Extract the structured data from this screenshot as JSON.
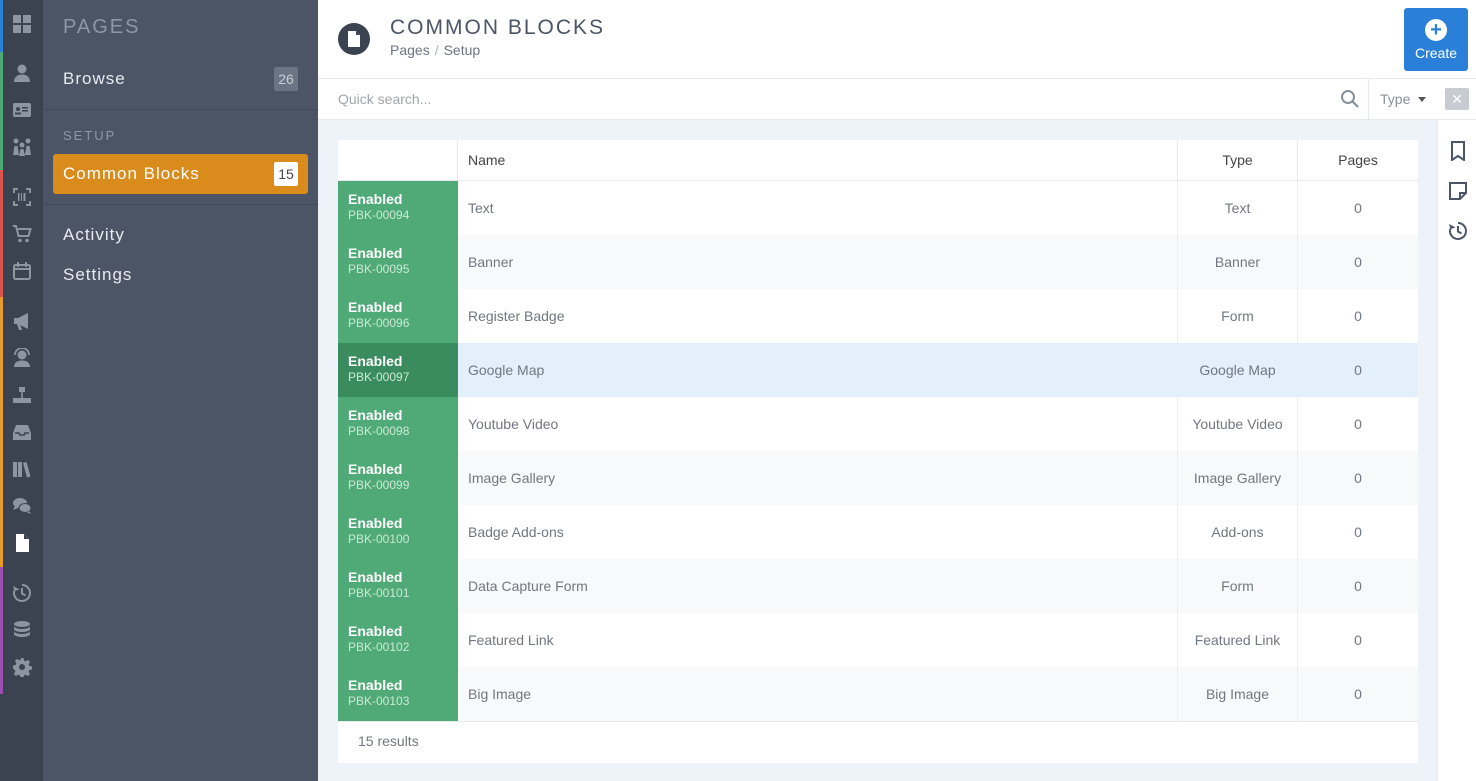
{
  "sidebar": {
    "title": "PAGES",
    "browse": {
      "label": "Browse",
      "count": "26"
    },
    "section_label": "SETUP",
    "common_blocks": {
      "label": "Common Blocks",
      "count": "15"
    },
    "activity_label": "Activity",
    "settings_label": "Settings"
  },
  "header": {
    "title": "COMMON BLOCKS",
    "breadcrumb": [
      "Pages",
      "Setup"
    ],
    "create_label": "Create"
  },
  "search": {
    "placeholder": "Quick search...",
    "type_label": "Type",
    "clear_label": "✕"
  },
  "table": {
    "columns": {
      "name": "Name",
      "type": "Type",
      "pages": "Pages"
    },
    "rows": [
      {
        "status": "Enabled",
        "code": "PBK-00094",
        "name": "Text",
        "type": "Text",
        "pages": "0"
      },
      {
        "status": "Enabled",
        "code": "PBK-00095",
        "name": "Banner",
        "type": "Banner",
        "pages": "0"
      },
      {
        "status": "Enabled",
        "code": "PBK-00096",
        "name": "Register Badge",
        "type": "Form",
        "pages": "0"
      },
      {
        "status": "Enabled",
        "code": "PBK-00097",
        "name": "Google Map",
        "type": "Google Map",
        "pages": "0"
      },
      {
        "status": "Enabled",
        "code": "PBK-00098",
        "name": "Youtube Video",
        "type": "Youtube Video",
        "pages": "0"
      },
      {
        "status": "Enabled",
        "code": "PBK-00099",
        "name": "Image Gallery",
        "type": "Image Gallery",
        "pages": "0"
      },
      {
        "status": "Enabled",
        "code": "PBK-00100",
        "name": "Badge Add-ons",
        "type": "Add-ons",
        "pages": "0"
      },
      {
        "status": "Enabled",
        "code": "PBK-00101",
        "name": "Data Capture Form",
        "type": "Form",
        "pages": "0"
      },
      {
        "status": "Enabled",
        "code": "PBK-00102",
        "name": "Featured Link",
        "type": "Featured Link",
        "pages": "0"
      },
      {
        "status": "Enabled",
        "code": "PBK-00103",
        "name": "Big Image",
        "type": "Big Image",
        "pages": "0"
      }
    ],
    "results_text": "15 results"
  },
  "colors": {
    "accent": "#d98c1c",
    "primary": "#2a80d8",
    "enabled": "#4faa78",
    "sidebar": "#4b5566",
    "rail": "#3b4350"
  }
}
